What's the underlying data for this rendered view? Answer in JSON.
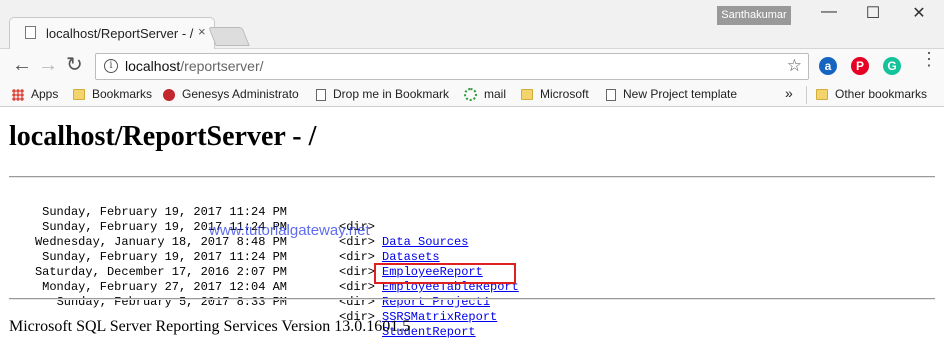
{
  "window": {
    "tab_title": "localhost/ReportServer - /",
    "tab_close": "×",
    "user": "Santhakumar",
    "controls": [
      "—",
      "☐",
      "✕"
    ]
  },
  "toolbar": {
    "back": "←",
    "forward": "→",
    "reload": "↻",
    "url_host": "localhost",
    "url_path": "/reportserver/",
    "star": "☆",
    "menu": "⋮"
  },
  "extensions": [
    {
      "name": "a",
      "color": "#1565c0"
    },
    {
      "name": "P",
      "color": "#e60023"
    },
    {
      "name": "G",
      "color": "#15c39a"
    }
  ],
  "bookmarks": {
    "items": [
      {
        "label": "Apps",
        "icon": "apps-icon"
      },
      {
        "label": "Bookmarks",
        "icon": "folder-icon"
      },
      {
        "label": "Genesys Administrato",
        "icon": "genesys-icon"
      },
      {
        "label": "Drop me in Bookmark",
        "icon": "page-icon"
      },
      {
        "label": "mail",
        "icon": "mail-icon"
      },
      {
        "label": "Microsoft",
        "icon": "folder-icon"
      },
      {
        "label": "New Project template",
        "icon": "page-icon"
      }
    ],
    "overflow": "»",
    "other": "Other bookmarks"
  },
  "page": {
    "heading": "localhost/ReportServer - /",
    "entries": [
      {
        "date": "Sunday, February 19, 2017 11:24 PM",
        "type": "<dir>",
        "name": "Data Sources"
      },
      {
        "date": "Sunday, February 19, 2017 11:24 PM",
        "type": "<dir>",
        "name": "Datasets"
      },
      {
        "date": "Wednesday, January 18, 2017 8:48 PM",
        "type": "<dir>",
        "name": "EmployeeReport"
      },
      {
        "date": "Sunday, February 19, 2017 11:24 PM",
        "type": "<dir>",
        "name": "EmployeeTableReport"
      },
      {
        "date": "Saturday, December 17, 2016 2:07 PM",
        "type": "<dir>",
        "name": "Report Project1"
      },
      {
        "date": "Monday, February 27, 2017 12:04 AM",
        "type": "<dir>",
        "name": "SSRSMatrixReport"
      },
      {
        "date": "Sunday, February 5, 2017 8:33 PM",
        "type": "<dir>",
        "name": "StudentReport"
      }
    ],
    "watermark": "www.tutorialgateway.net",
    "footer": "Microsoft SQL Server Reporting Services Version 13.0.1601.5"
  }
}
